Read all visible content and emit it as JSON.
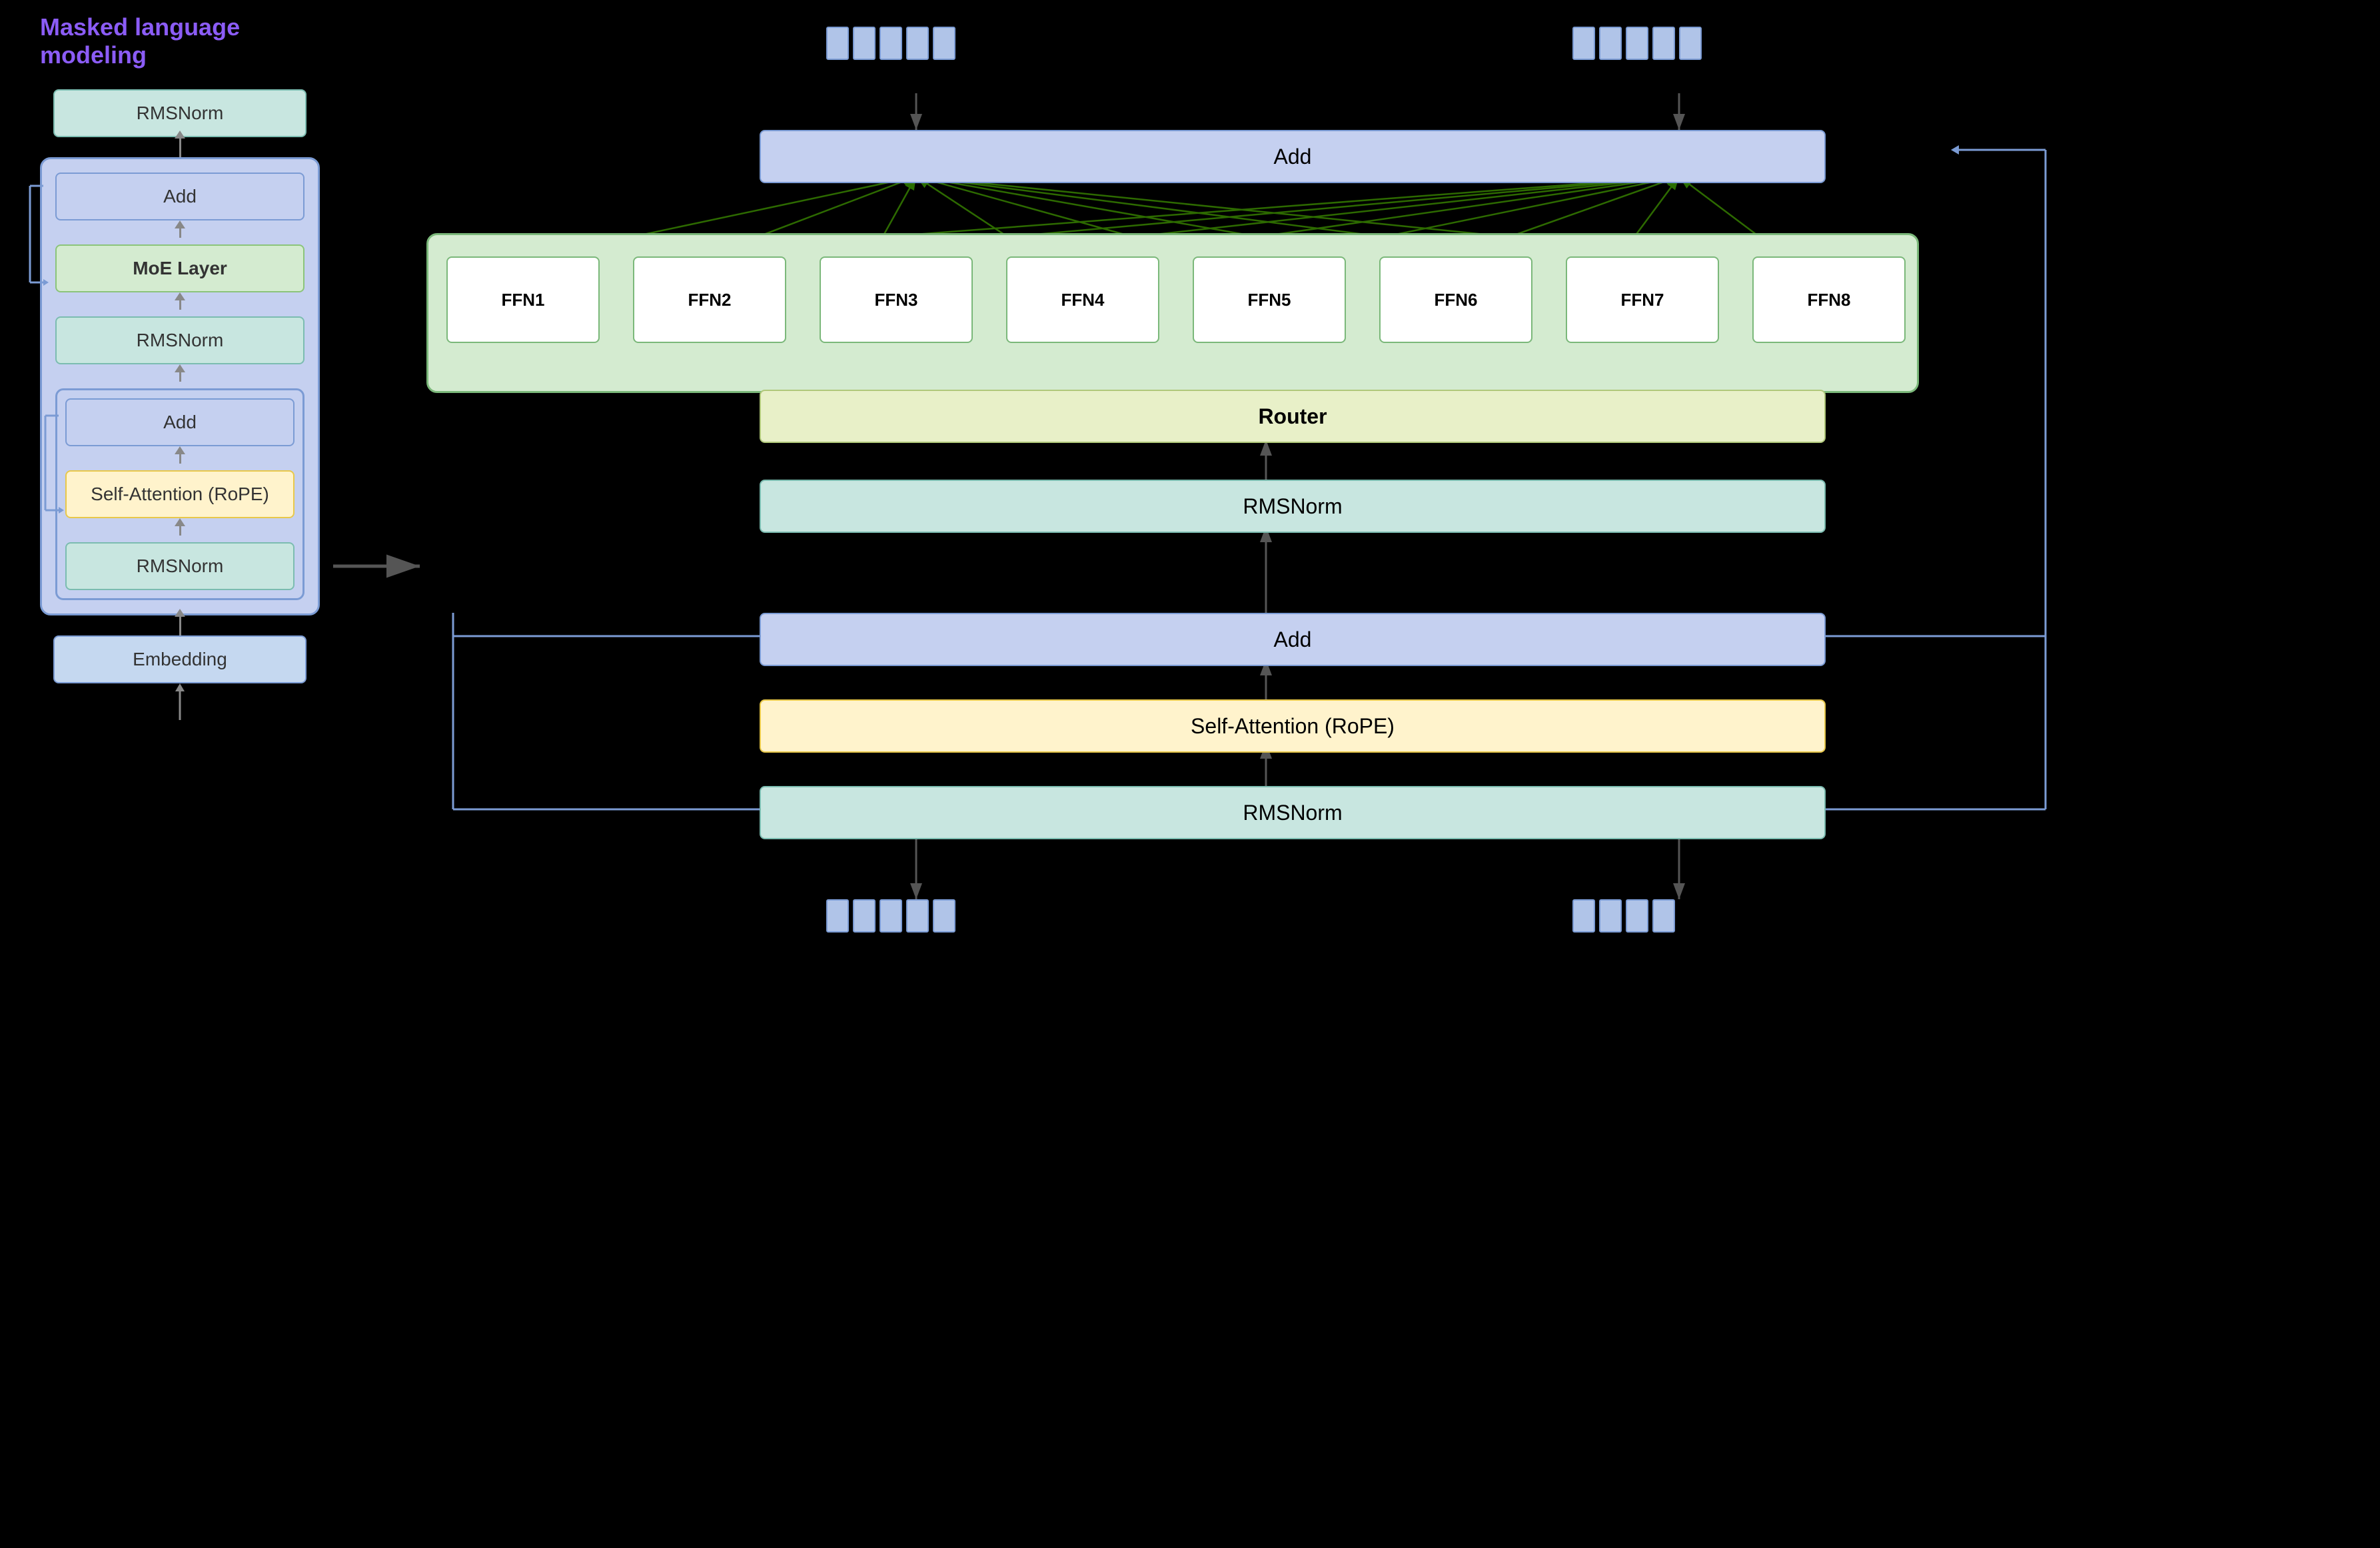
{
  "title": "Masked language modeling",
  "left": {
    "rmsnorm_top": "RMSNorm",
    "add_top": "Add",
    "moe_layer": "MoE Layer",
    "rmsnorm_mid": "RMSNorm",
    "add_bot": "Add",
    "self_attention": "Self-Attention (RoPE)",
    "rmsnorm_bot": "RMSNorm",
    "embedding": "Embedding"
  },
  "right": {
    "add_top": "Add",
    "ffn_labels": [
      "FFN1",
      "FFN2",
      "FFN3",
      "FFN4",
      "FFN5",
      "FFN6",
      "FFN7",
      "FFN8"
    ],
    "router": "Router",
    "rmsnorm_router": "RMSNorm",
    "add_mid": "Add",
    "self_attention": "Self-Attention (RoPE)",
    "rmsnorm_bot": "RMSNorm"
  },
  "colors": {
    "add": "#C5D0F0",
    "add_border": "#7B9BD4",
    "moe": "#D4EBD0",
    "moe_border": "#8BC47A",
    "rmsnorm": "#C8E6E0",
    "rmsnorm_border": "#7BBCB0",
    "attention": "#FFF3CC",
    "attention_border": "#E8C84A",
    "embedding": "#C5D8F0",
    "embedding_border": "#7B9BD4",
    "router": "#E8F0C8",
    "router_border": "#B8C87A",
    "ffn_bg": "#D4EBD0",
    "ffn_border": "#8BC47A",
    "title_color": "#8B5CF6"
  }
}
